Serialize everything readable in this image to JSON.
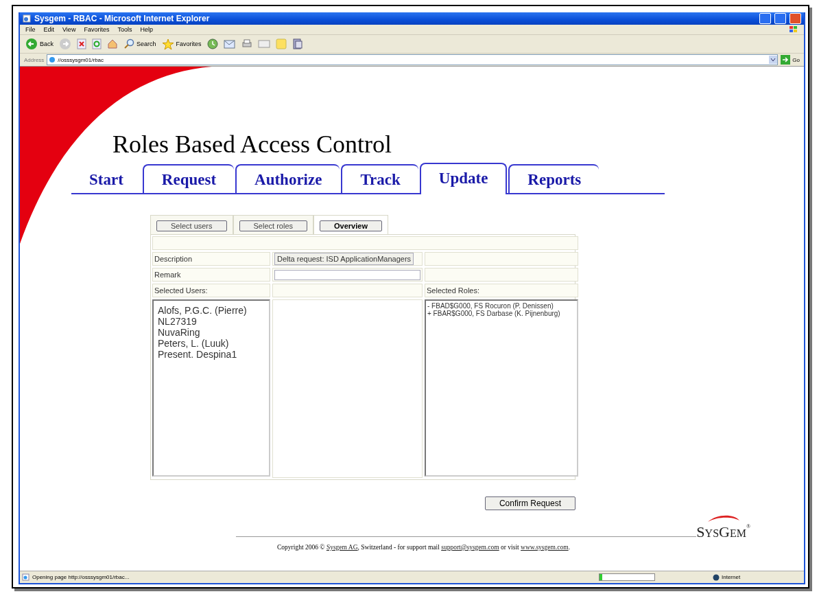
{
  "window": {
    "title": "Sysgem - RBAC - Microsoft Internet Explorer"
  },
  "menu": [
    "File",
    "Edit",
    "View",
    "Favorites",
    "Tools",
    "Help"
  ],
  "toolbar": {
    "back": "Back",
    "search": "Search",
    "favorites": "Favorites"
  },
  "address": {
    "label": "Address",
    "url": "//osssysgm01/rbac",
    "go": "Go"
  },
  "page": {
    "heading": "Roles Based Access Control",
    "tabs": [
      {
        "label": "Start",
        "selected": false
      },
      {
        "label": "Request",
        "selected": false
      },
      {
        "label": "Authorize",
        "selected": false
      },
      {
        "label": "Track",
        "selected": false
      },
      {
        "label": "Update",
        "selected": true
      },
      {
        "label": "Reports",
        "selected": false
      }
    ],
    "subtabs": [
      {
        "label": "Select users",
        "selected": false
      },
      {
        "label": "Select roles",
        "selected": false
      },
      {
        "label": "Overview",
        "selected": true
      }
    ],
    "description": {
      "label": "Description",
      "value": "Delta request: ISD ApplicationManagers"
    },
    "remark": {
      "label": "Remark"
    },
    "users_label": "Selected Users:",
    "roles_label": "Selected Roles:",
    "users": [
      "Alofs, P.G.C. (Pierre)",
      "NL27319",
      "NuvaRing",
      "Peters, L. (Luuk)",
      "Present. Despina1"
    ],
    "roles": [
      "- FBAD$G000, FS Rocuron (P. Denissen)",
      "+ FBAR$G000, FS Darbase (K. Pijnenburg)"
    ],
    "confirm": "Confirm Request",
    "logo": {
      "parts": [
        {
          "text": "S",
          "kind": "initial"
        },
        {
          "text": "YS",
          "kind": "rest"
        },
        {
          "text": "G",
          "kind": "initial"
        },
        {
          "text": "EM",
          "kind": "rest"
        }
      ],
      "mark": "®"
    },
    "footer": [
      {
        "text": "Copyright 2006 © ",
        "kind": "text"
      },
      {
        "text": "Sysgem AG",
        "kind": "link"
      },
      {
        "text": ", Switzerland - for support mail ",
        "kind": "text"
      },
      {
        "text": "support@sysgem.com",
        "kind": "link"
      },
      {
        "text": " or visit ",
        "kind": "text"
      },
      {
        "text": "www.sysgem.com",
        "kind": "link"
      },
      {
        "text": ".",
        "kind": "text"
      }
    ]
  },
  "status_bar": {
    "text": "Opening page http://osssysgm01/rbac...",
    "level": 0.05,
    "zone": "Internet"
  }
}
